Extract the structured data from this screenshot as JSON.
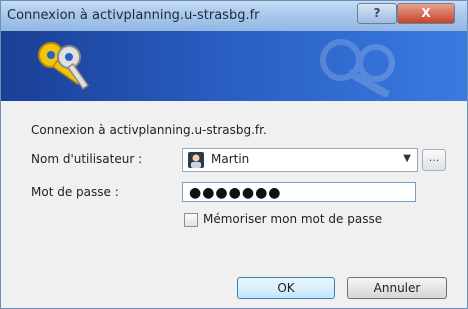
{
  "window": {
    "title": "Connexion à activplanning.u-strasbg.fr",
    "help_label": "?",
    "close_label": "X"
  },
  "dialog": {
    "prompt": "Connexion à activplanning.u-strasbg.fr.",
    "username_label": "Nom d'utilisateur :",
    "username_value": "Martin",
    "browse_label": "...",
    "password_label": "Mot de passe :",
    "password_value": "●●●●●●●",
    "remember_label": "Mémoriser mon mot de passe",
    "ok_label": "OK",
    "cancel_label": "Annuler"
  },
  "colors": {
    "banner": "#2a5fc4",
    "titlebar": "#a9c8ec",
    "ok_button": "#bee6fd"
  }
}
